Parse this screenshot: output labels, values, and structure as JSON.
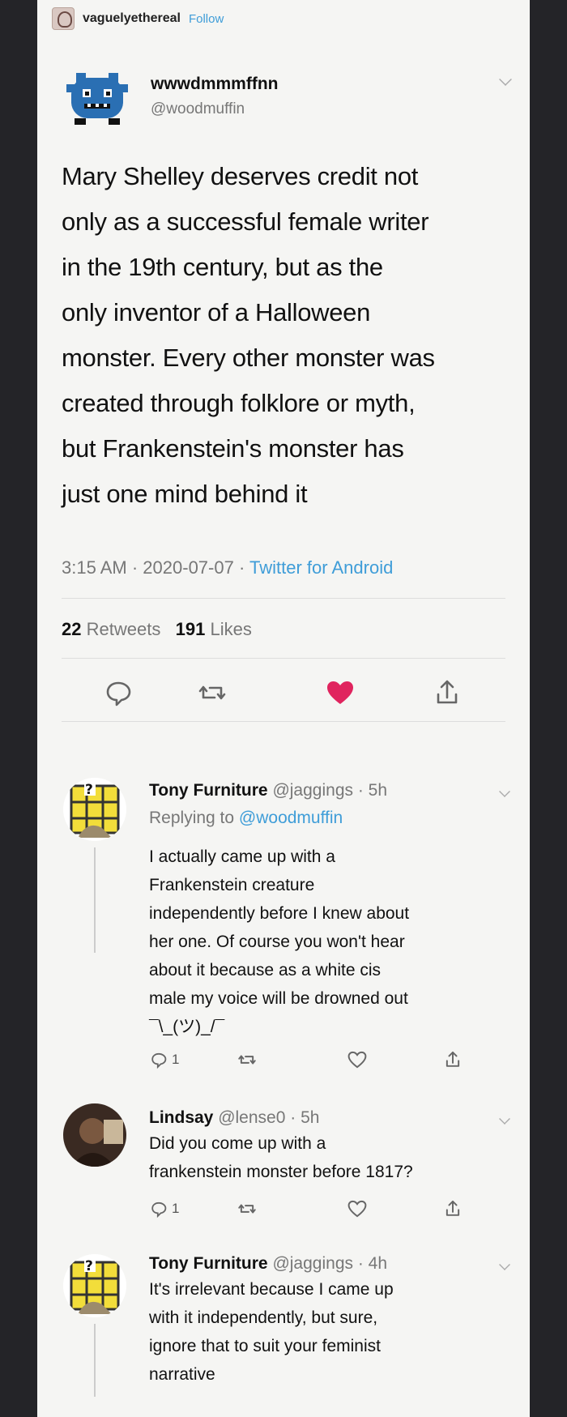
{
  "tumblr": {
    "username": "vaguelyethereal",
    "follow_label": "Follow"
  },
  "tweet": {
    "display_name": "wwwdmmmffnn",
    "handle": "@woodmuffin",
    "text": "Mary Shelley deserves credit not\nonly as a successful female writer\nin the 19th century, but as the\nonly inventor of a Halloween\nmonster. Every other monster was\ncreated through folklore or myth,\nbut Frankenstein's monster has\njust one mind behind it",
    "time": "3:15 AM",
    "date": "2020-07-07",
    "source": "Twitter for Android",
    "retweets_count": "22",
    "retweets_label": "Retweets",
    "likes_count": "191",
    "likes_label": "Likes",
    "liked": true,
    "heart_color": "#e0245e"
  },
  "replies": [
    {
      "name": "Tony Furniture",
      "handle": "@jaggings",
      "age": "· 5h",
      "replying_prefix": "Replying to",
      "replying_to": "@woodmuffin",
      "text": "I actually came up with a\nFrankenstein creature\nindependently before I knew about\nher one. Of course you won't hear\nabout it because as a white cis\nmale my voice will be drowned out\n¯\\_(ツ)_/¯",
      "reply_count": "1"
    },
    {
      "name": "Lindsay",
      "handle": "@lense0",
      "age": "· 5h",
      "text": "Did you come up with a\nfrankenstein monster before 1817?",
      "reply_count": "1"
    },
    {
      "name": "Tony Furniture",
      "handle": "@jaggings",
      "age": "· 4h",
      "text": "It's irrelevant because I came up\nwith it independently, but sure,\nignore that to suit your feminist\nnarrative"
    }
  ],
  "colors": {
    "link": "#3f9dd8",
    "muted": "#777777"
  }
}
